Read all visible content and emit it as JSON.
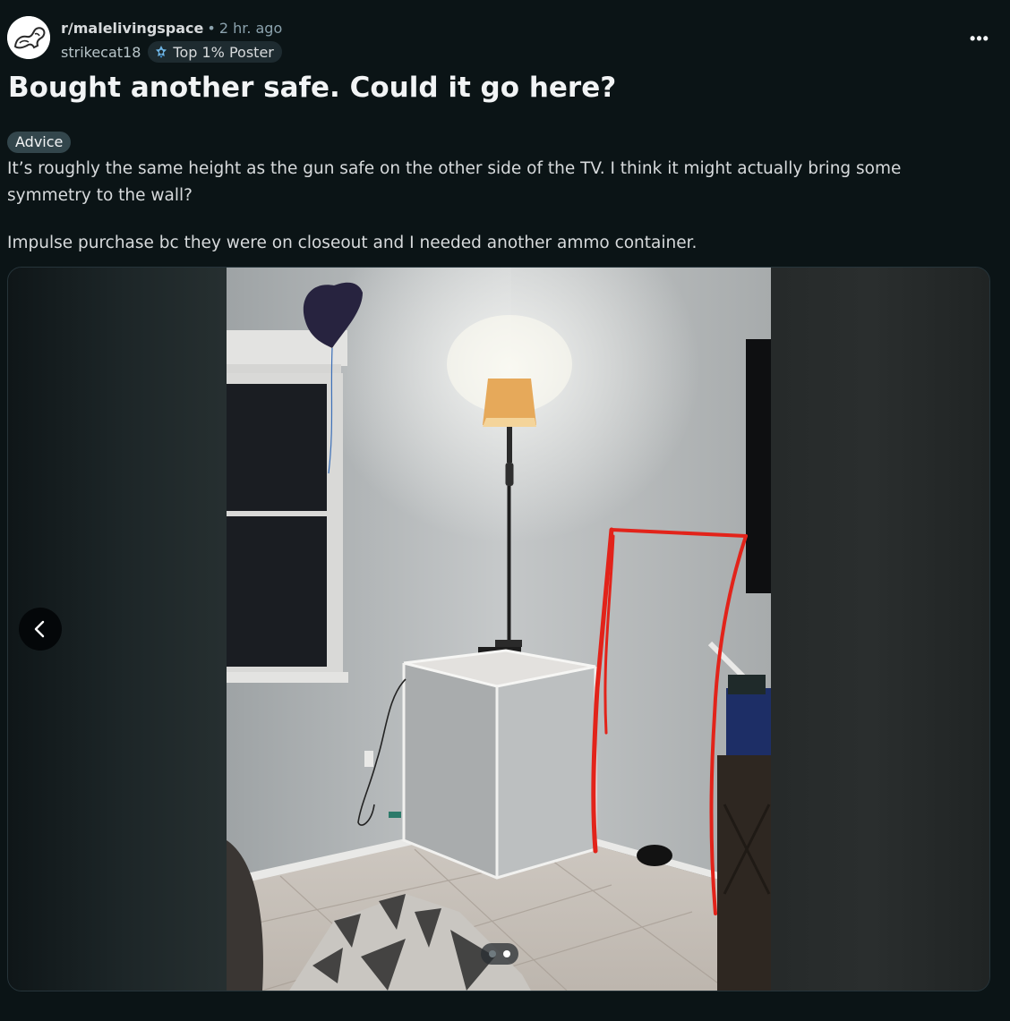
{
  "post": {
    "subreddit": "r/malelivingspace",
    "separator": "•",
    "time_ago": "2 hr. ago",
    "username": "strikecat18",
    "user_badge": "Top 1% Poster",
    "title": "Bought another safe. Could it go here?",
    "flair": "Advice",
    "body": [
      "It’s roughly the same height as the gun safe on the other side of the TV. I think it might actually bring some symmetry to the wall?",
      "Impulse purchase bc they were on closeout and I needed another ammo container."
    ],
    "more_options_glyph": "•••"
  },
  "gallery": {
    "slide_count": 2,
    "current_slide": 2
  },
  "icons": {
    "avatar": "subreddit-avatar-icon",
    "badge": "top-poster-badge-icon",
    "overflow": "more-options-icon",
    "prev": "chevron-left-icon"
  },
  "colors": {
    "background": "#0b1416",
    "title": "#f2f4f5",
    "meta": "#8ba2ad",
    "flair_bg": "#33464c",
    "annotation_red": "#e2231a"
  }
}
